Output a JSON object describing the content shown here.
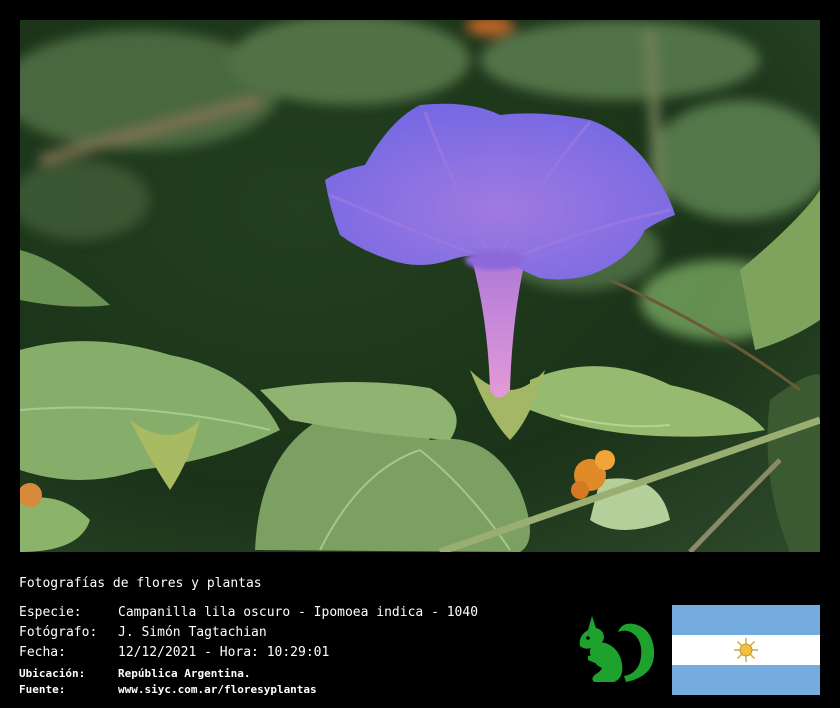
{
  "caption": {
    "title": "Fotografías de flores y plantas",
    "rows": [
      {
        "label": "Especie:",
        "value": "Campanilla lila oscuro - Ipomoea indica - 1040"
      },
      {
        "label": "Fotógrafo:",
        "value": "J. Simón Tagtachian"
      },
      {
        "label": "Fecha:",
        "value": "12/12/2021 - Hora: 10:29:01"
      }
    ],
    "small_rows": [
      {
        "label": "Ubicación:",
        "value": "República Argentina."
      },
      {
        "label": "Fuente:",
        "value": "www.siyc.com.ar/floresyplantas"
      }
    ]
  },
  "photo": {
    "subject": "purple-morning-glory-flower",
    "colors": {
      "background_dark": "#1c3319",
      "leaf": "#7fa862",
      "flower_purple": "#7a6fe8",
      "flower_tube": "#d48ad8"
    }
  },
  "logo": {
    "icon": "green-squirrel-icon",
    "color": "#1fa12e"
  },
  "flag": {
    "icon": "argentina-flag-icon",
    "colors": {
      "blue": "#74acdf",
      "white": "#ffffff",
      "sun": "#d4a537"
    }
  }
}
